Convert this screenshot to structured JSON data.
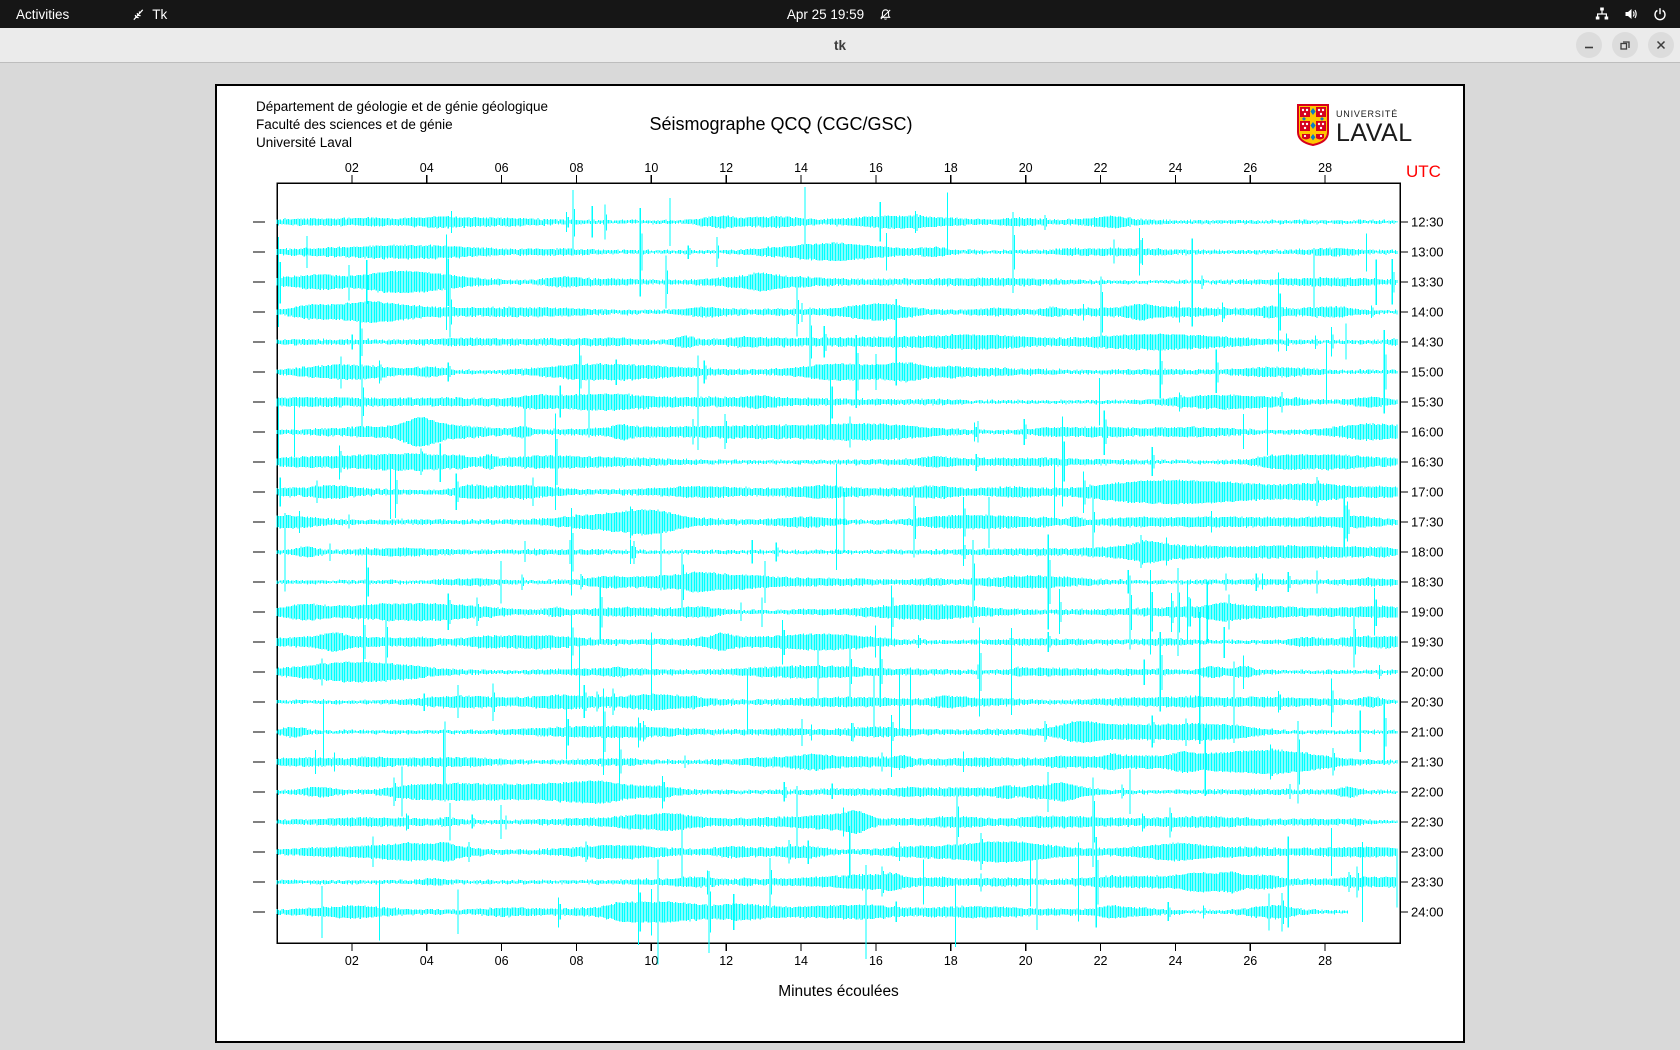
{
  "topbar": {
    "activities": "Activities",
    "app_indicator": "Tk",
    "clock": "Apr 25 19:59",
    "icons": [
      "tk-feather-icon",
      "notifications-disabled-icon",
      "network-wired-icon",
      "volume-icon",
      "power-icon"
    ]
  },
  "titlebar": {
    "title": "tk",
    "buttons": [
      "minimize",
      "restore",
      "close"
    ]
  },
  "header": {
    "line1": "Département de géologie et de génie géologique",
    "line2": "Faculté des sciences et de génie",
    "line3": "Université Laval"
  },
  "logo": {
    "small": "UNIVERSITÉ",
    "large": "LAVAL",
    "colors": {
      "red": "#d6001c",
      "gold": "#ffc600",
      "blue": "#0e7ac4"
    }
  },
  "plot": {
    "title": "Séismographe QCQ (CGC/GSC)",
    "utc_label": "UTC",
    "xlabel": "Minutes écoulées",
    "x_ticks": [
      "02",
      "04",
      "06",
      "08",
      "10",
      "12",
      "14",
      "16",
      "18",
      "20",
      "22",
      "24",
      "26",
      "28"
    ],
    "minutes_range": [
      0,
      30
    ],
    "time_labels": [
      "12:30",
      "13:00",
      "13:30",
      "14:00",
      "14:30",
      "15:00",
      "15:30",
      "16:00",
      "16:30",
      "17:00",
      "17:30",
      "18:00",
      "18:30",
      "19:00",
      "19:30",
      "20:00",
      "20:30",
      "21:00",
      "21:30",
      "22:00",
      "22:30",
      "23:00",
      "23:30",
      "24:00"
    ],
    "trace_color": "#00ffff",
    "utc_color": "#ff0000",
    "seed": 1337,
    "last_trace_end_minute": 28.65,
    "events": [
      {
        "row": 0,
        "minute": 10.5,
        "amp": 24
      },
      {
        "row": 1,
        "minute": 0.8,
        "amp": 16
      },
      {
        "row": 2,
        "minute": 2.4,
        "amp": 22
      },
      {
        "row": 5,
        "minute": 16.0,
        "amp": 18
      },
      {
        "row": 9,
        "minute": 14.95,
        "amp": 28
      },
      {
        "row": 10,
        "minute": 14.95,
        "amp": 48
      },
      {
        "row": 10,
        "minute": 15.15,
        "amp": 30
      },
      {
        "row": 13,
        "minute": 24.85,
        "amp": 30
      },
      {
        "row": 15,
        "minute": 24.65,
        "amp": 60
      },
      {
        "row": 16,
        "minute": 24.65,
        "amp": 42
      },
      {
        "row": 18,
        "minute": 24.8,
        "amp": 34
      },
      {
        "row": 19,
        "minute": 20.6,
        "amp": 20
      },
      {
        "row": 21,
        "minute": 15.3,
        "amp": 26
      },
      {
        "row": 22,
        "minute": 29.0,
        "amp": 40
      },
      {
        "row": 23,
        "minute": 1.2,
        "amp": 26
      },
      {
        "row": 23,
        "minute": 12.2,
        "amp": 18
      }
    ]
  }
}
